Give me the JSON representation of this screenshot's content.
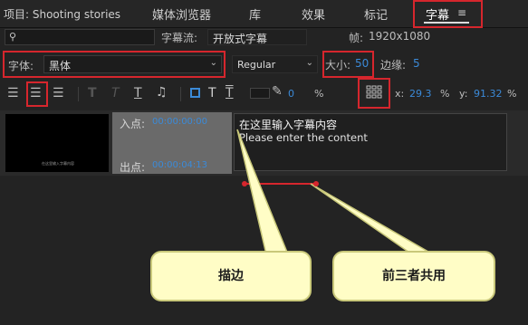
{
  "tabs": {
    "project": "项目: Shooting stories",
    "media_browser": "媒体浏览器",
    "library": "库",
    "effects": "效果",
    "markers": "标记",
    "captions": "字幕",
    "menu_icon": "≡"
  },
  "captions_panel": {
    "caption_stream_label": "字幕流:",
    "caption_stream_value": "开放式字幕",
    "frame_label": "帧:",
    "frame_value": "1920x1080",
    "font_label": "字体:",
    "font_value": "黑体",
    "style_value": "Regular",
    "size_label": "大小:",
    "size_value": "50",
    "edge_label": "边缘:",
    "edge_value": "5",
    "opacity_value": "0",
    "opacity_unit": "%",
    "x_label": "x:",
    "x_value": "29.3",
    "x_unit": "%",
    "y_label": "y:",
    "y_value": "91.32",
    "y_unit": "%",
    "in_label": "入点:",
    "in_time": "00:00:00:00",
    "out_label": "出点:",
    "out_time": "00:00:04:13",
    "thumb_caption": "在这里输入字幕内容",
    "caption_line1": "在这里输入字幕内容",
    "caption_line2": "Please enter the content"
  },
  "annotations": {
    "stroke": "描边",
    "shared": "前三者共用"
  },
  "colors": {
    "accent_blue": "#3b8ad8",
    "annotation_red": "#d6262d",
    "callout_fill": "#fffdc6"
  }
}
